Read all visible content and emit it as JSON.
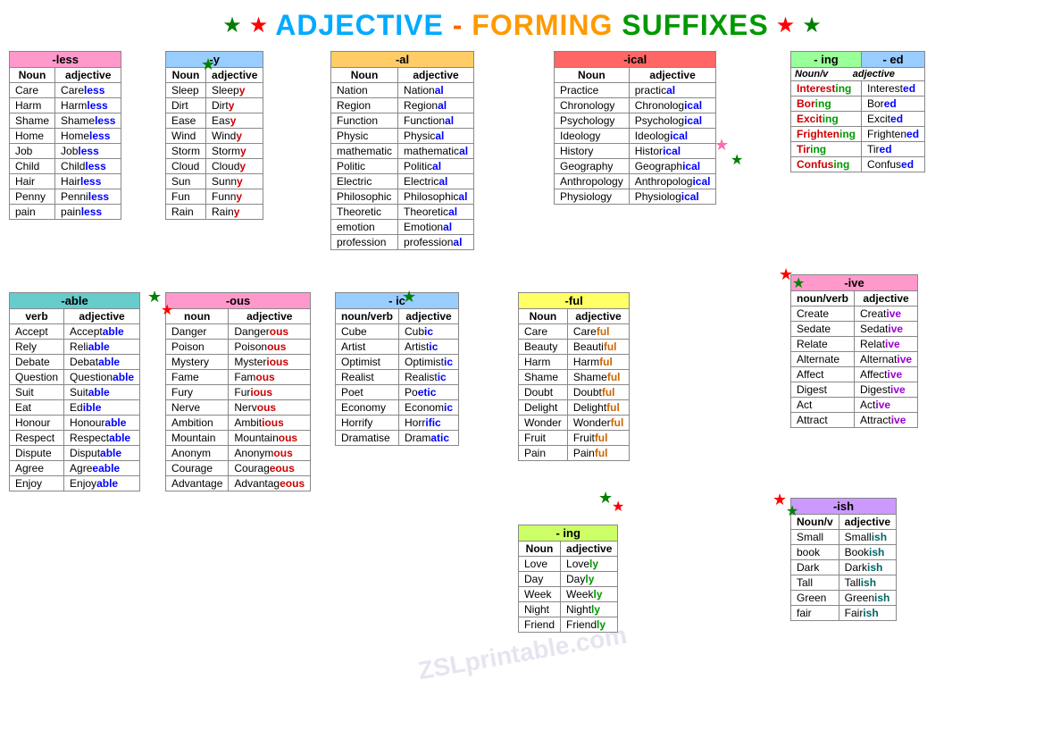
{
  "title": {
    "part1": "ADJECTIVE",
    "dash": " - ",
    "part2": "FORMING",
    "part3": "SUFFIXES"
  },
  "watermark": "ZSLprintable.com",
  "tables": {
    "less": {
      "header": "-less",
      "col1": "Noun",
      "col2": "adjective",
      "rows": [
        [
          "Care",
          "Careless"
        ],
        [
          "Harm",
          "Harmless"
        ],
        [
          "Shame",
          "Shameless"
        ],
        [
          "Home",
          "Homeless"
        ],
        [
          "Job",
          "Jobless"
        ],
        [
          "Child",
          "Childless"
        ],
        [
          "Hair",
          "Hairless"
        ],
        [
          "Penny",
          "Penniless"
        ],
        [
          "pain",
          "painless"
        ]
      ],
      "suffixes": [
        "less",
        "less",
        "less",
        "less",
        "less",
        "less",
        "less",
        "less",
        "less"
      ]
    },
    "y": {
      "header": "-y",
      "col1": "Noun",
      "col2": "adjective",
      "rows": [
        [
          "Sleep",
          "Sleepy"
        ],
        [
          "Dirt",
          "Dirty"
        ],
        [
          "Ease",
          "Easy"
        ],
        [
          "Wind",
          "Windy"
        ],
        [
          "Storm",
          "Stormy"
        ],
        [
          "Cloud",
          "Cloudy"
        ],
        [
          "Sun",
          "Sunny"
        ],
        [
          "Fun",
          "Funny"
        ],
        [
          "Rain",
          "Rainy"
        ]
      ]
    },
    "al": {
      "header": "-al",
      "col1": "Noun",
      "col2": "adjective",
      "rows": [
        [
          "Nation",
          "National"
        ],
        [
          "Region",
          "Regional"
        ],
        [
          "Function",
          "Functional"
        ],
        [
          "Physic",
          "Physical"
        ],
        [
          "mathematic",
          "mathematical"
        ],
        [
          "Politic",
          "Political"
        ],
        [
          "Electric",
          "Electrical"
        ],
        [
          "Philosophic",
          "Philosophical"
        ],
        [
          "Theoretic",
          "Theoretical"
        ],
        [
          "emotion",
          "Emotional"
        ],
        [
          "profession",
          "professional"
        ]
      ]
    },
    "ical": {
      "header": "-ical",
      "col1": "Noun",
      "col2": "adjective",
      "rows": [
        [
          "Practice",
          "practical"
        ],
        [
          "Chronology",
          "Chronological"
        ],
        [
          "Psychology",
          "Psychological"
        ],
        [
          "Ideology",
          "Ideological"
        ],
        [
          "History",
          "Historical"
        ],
        [
          "Geography",
          "Geographical"
        ],
        [
          "Anthropology",
          "Anthropological"
        ],
        [
          "Physiology",
          "Physiological"
        ]
      ]
    },
    "ing_ed": {
      "header_ing": "- ing",
      "header_ed": "- ed",
      "col1": "Noun/v",
      "col2": "adjective",
      "rows": [
        [
          "Interesting",
          "Interested"
        ],
        [
          "Boring",
          "Bored"
        ],
        [
          "Exciting",
          "Excited"
        ],
        [
          "Frightening",
          "Frightened"
        ],
        [
          "Tiring",
          "Tired"
        ],
        [
          "Confusing",
          "Confused"
        ]
      ]
    },
    "able": {
      "header": "-able",
      "col1": "verb",
      "col2": "adjective",
      "rows": [
        [
          "Accept",
          "Acceptable"
        ],
        [
          "Rely",
          "Reliable"
        ],
        [
          "Debate",
          "Debatable"
        ],
        [
          "Question",
          "Questionable"
        ],
        [
          "Suit",
          "Suitable"
        ],
        [
          "Eat",
          "Edible"
        ],
        [
          "Honour",
          "Honourable"
        ],
        [
          "Respect",
          "Respectable"
        ],
        [
          "Dispute",
          "Disputable"
        ],
        [
          "Agree",
          "Agreeable"
        ],
        [
          "Enjoy",
          "Enjoyable"
        ]
      ]
    },
    "ous": {
      "header": "-ous",
      "col1": "noun",
      "col2": "adjective",
      "rows": [
        [
          "Danger",
          "Dangerous"
        ],
        [
          "Poison",
          "Poisonous"
        ],
        [
          "Mystery",
          "Mysterious"
        ],
        [
          "Fame",
          "Famous"
        ],
        [
          "Fury",
          "Furious"
        ],
        [
          "Nerve",
          "Nervous"
        ],
        [
          "Ambition",
          "Ambitious"
        ],
        [
          "Mountain",
          "Mountainous"
        ],
        [
          "Anonym",
          "Anonymous"
        ],
        [
          "Courage",
          "Courageous"
        ],
        [
          "Advantage",
          "Advantageous"
        ]
      ]
    },
    "ic": {
      "header": "- ic",
      "col1": "noun/verb",
      "col2": "adjective",
      "rows": [
        [
          "Cube",
          "Cubic"
        ],
        [
          "Artist",
          "Artistic"
        ],
        [
          "Optimist",
          "Optimistic"
        ],
        [
          "Realist",
          "Realistic"
        ],
        [
          "Poet",
          "Poetic"
        ],
        [
          "Economy",
          "Economic"
        ],
        [
          "Horrify",
          "Horrific"
        ],
        [
          "Dramatise",
          "Dramatic"
        ]
      ]
    },
    "ful": {
      "header": "-ful",
      "col1": "Noun",
      "col2": "adjective",
      "rows": [
        [
          "Care",
          "Careful"
        ],
        [
          "Beauty",
          "Beautiful"
        ],
        [
          "Harm",
          "Harmful"
        ],
        [
          "Shame",
          "Shameful"
        ],
        [
          "Doubt",
          "Doubtful"
        ],
        [
          "Delight",
          "Delightful"
        ],
        [
          "Wonder",
          "Wonderful"
        ],
        [
          "Fruit",
          "Fruitful"
        ],
        [
          "Pain",
          "Painful"
        ]
      ]
    },
    "ive": {
      "header": "-ive",
      "col1": "noun/verb",
      "col2": "adjective",
      "rows": [
        [
          "Create",
          "Creative"
        ],
        [
          "Sedate",
          "Sedative"
        ],
        [
          "Relate",
          "Relative"
        ],
        [
          "Alternate",
          "Alternative"
        ],
        [
          "Affect",
          "Affective"
        ],
        [
          "Digest",
          "Digestive"
        ],
        [
          "Act",
          "Active"
        ],
        [
          "Attract",
          "Attractive"
        ]
      ]
    },
    "ing2": {
      "header": "- ing",
      "col1": "Noun",
      "col2": "adjective",
      "rows": [
        [
          "Love",
          "Lovely"
        ],
        [
          "Day",
          "Dayly"
        ],
        [
          "Week",
          "Weekly"
        ],
        [
          "Night",
          "Nightly"
        ],
        [
          "Friend",
          "Friendly"
        ]
      ]
    },
    "ish": {
      "header": "-ish",
      "col1": "Noun/v",
      "col2": "adjective",
      "rows": [
        [
          "Small",
          "Smallish"
        ],
        [
          "book",
          "Bookish"
        ],
        [
          "Dark",
          "Darkish"
        ],
        [
          "Tall",
          "Tallish"
        ],
        [
          "Green",
          "Greenish"
        ],
        [
          "fair",
          "Fairish"
        ]
      ]
    }
  }
}
